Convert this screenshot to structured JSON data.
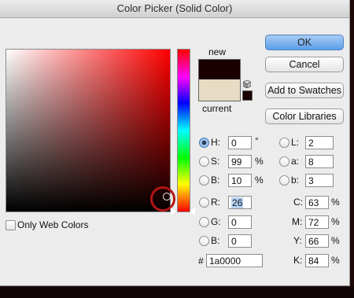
{
  "window": {
    "title": "Color Picker (Solid Color)"
  },
  "swatch": {
    "new_label": "new",
    "current_label": "current",
    "new_color": "#1a0000",
    "current_color": "#e6dcc3"
  },
  "buttons": {
    "ok": "OK",
    "cancel": "Cancel",
    "add_to_swatches": "Add to Swatches",
    "color_libraries": "Color Libraries"
  },
  "options": {
    "only_web_colors": "Only Web Colors"
  },
  "hsb": {
    "h": {
      "label": "H:",
      "value": "0",
      "unit": "°"
    },
    "s": {
      "label": "S:",
      "value": "99",
      "unit": "%"
    },
    "b": {
      "label": "B:",
      "value": "10",
      "unit": "%"
    }
  },
  "rgb": {
    "r": {
      "label": "R:",
      "value": "26"
    },
    "g": {
      "label": "G:",
      "value": "0"
    },
    "b": {
      "label": "B:",
      "value": "0"
    }
  },
  "lab": {
    "l": {
      "label": "L:",
      "value": "2"
    },
    "a": {
      "label": "a:",
      "value": "8"
    },
    "b": {
      "label": "b:",
      "value": "3"
    }
  },
  "cmyk": {
    "c": {
      "label": "C:",
      "value": "63",
      "unit": "%"
    },
    "m": {
      "label": "M:",
      "value": "72",
      "unit": "%"
    },
    "y": {
      "label": "Y:",
      "value": "66",
      "unit": "%"
    },
    "k": {
      "label": "K:",
      "value": "84",
      "unit": "%"
    }
  },
  "hex": {
    "label": "#",
    "value": "1a0000"
  },
  "selected_mode": "H",
  "icons": [
    "gamut-cube-icon",
    "web-color-swatch-icon"
  ]
}
